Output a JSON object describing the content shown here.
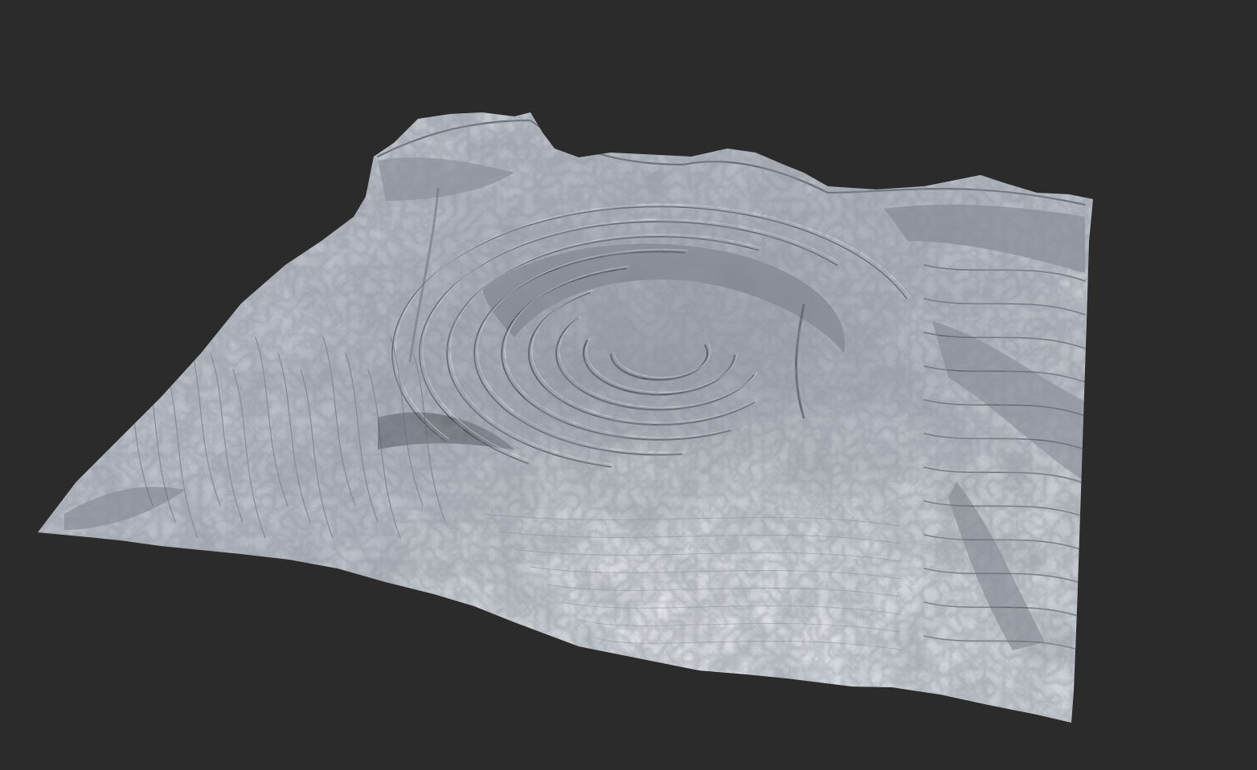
{
  "scene": {
    "background_color": "#2b2b2b",
    "terrain_base_color": "#b9bec6",
    "terrain_light_color": "#e6e9ee",
    "terrain_shadow_color": "#4a4f58",
    "terrain_deep_shadow_color": "#2c3038",
    "subject": "terrain-heightmap-render"
  }
}
